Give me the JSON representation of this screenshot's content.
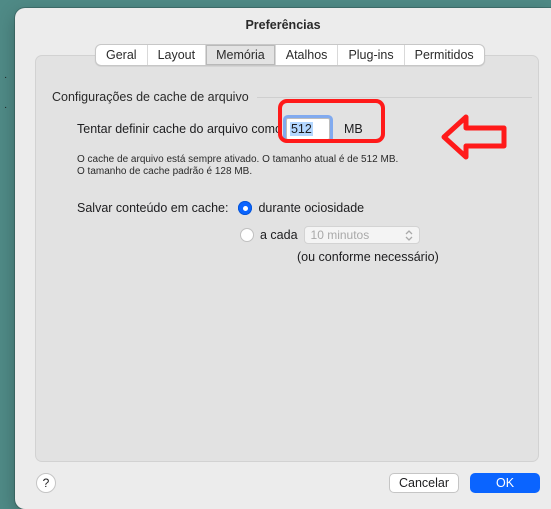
{
  "window": {
    "title": "Preferências"
  },
  "tabs": [
    {
      "label": "Geral",
      "selected": false
    },
    {
      "label": "Layout",
      "selected": false
    },
    {
      "label": "Memória",
      "selected": true
    },
    {
      "label": "Atalhos",
      "selected": false
    },
    {
      "label": "Plug-ins",
      "selected": false
    },
    {
      "label": "Permitidos",
      "selected": false
    }
  ],
  "cache": {
    "section_title": "Configurações de cache de arquivo",
    "label": "Tentar definir cache do arquivo como",
    "value": "512",
    "unit": "MB",
    "info_line1": "O cache de arquivo está sempre ativado. O tamanho atual é de 512 MB.",
    "info_line2": "O tamanho de cache padrão é 128 MB."
  },
  "save": {
    "label": "Salvar conteúdo em cache:",
    "option_idle": "durante ociosidade",
    "option_each": "a cada",
    "interval_value": "10 minutos",
    "note": "(ou conforme necessário)"
  },
  "buttons": {
    "help": "?",
    "cancel": "Cancelar",
    "ok": "OK"
  },
  "colors": {
    "accent": "#0a64ff",
    "annotation": "#ff1a1a",
    "background": "#4f8a86"
  },
  "icons": {
    "stepper": "chevron-up-down-icon",
    "annotation_arrow": "left-arrow-icon"
  }
}
